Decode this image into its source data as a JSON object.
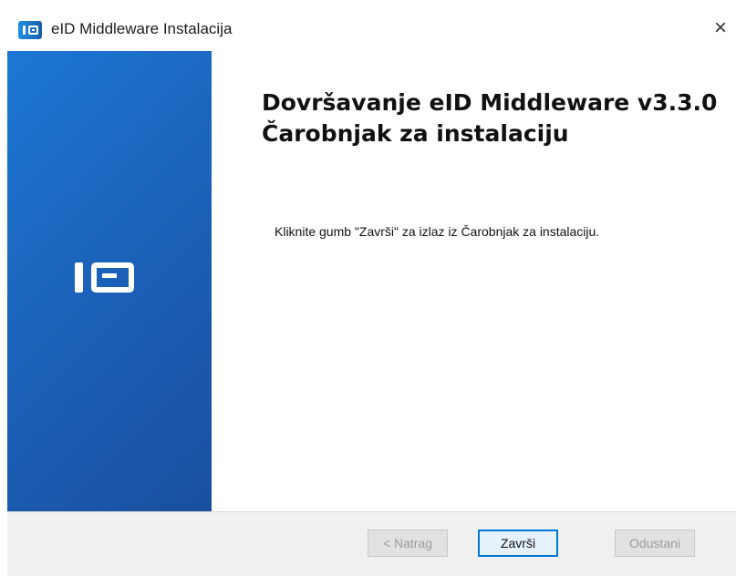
{
  "window": {
    "title": "eID Middleware Instalacija",
    "close_glyph": "×",
    "icon": "eid-app-icon"
  },
  "banner": {
    "logo": "eid-logo-icon",
    "gradient_colors": [
      "#1c78d4",
      "#1a4f9f"
    ]
  },
  "main": {
    "heading": "Dovršavanje eID Middleware v3.3.0 Čarobnjak za instalaciju",
    "message": "Kliknite gumb \"Završi\" za izlaz iz Čarobnjak za instalaciju."
  },
  "footer": {
    "back_label": "< Natrag",
    "finish_label": "Završi",
    "cancel_label": "Odustani"
  },
  "colors": {
    "accent": "#0078d7",
    "footer_bg": "#f0f0f0",
    "disabled_text": "#9c9c9c"
  }
}
